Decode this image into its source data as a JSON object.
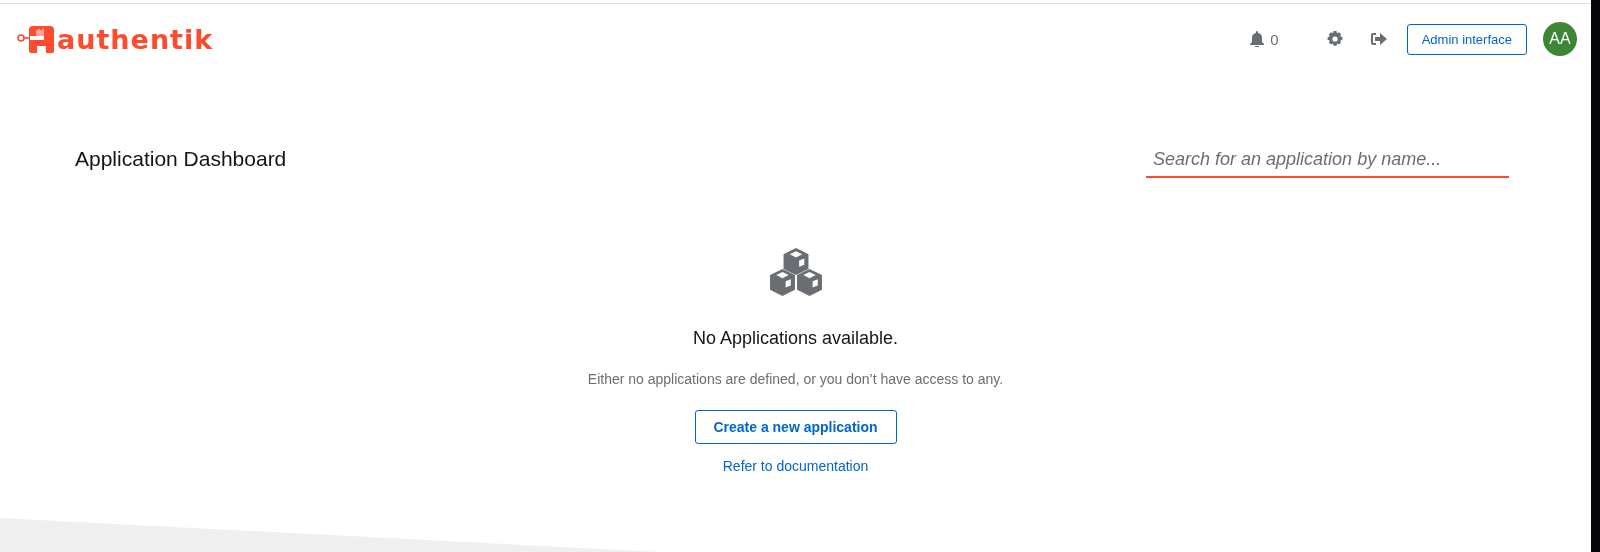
{
  "header": {
    "brand": "authentik",
    "notifications": {
      "count": "0"
    },
    "admin_button": "Admin interface",
    "avatar": "AA"
  },
  "dashboard": {
    "title": "Application Dashboard",
    "search": {
      "placeholder": "Search for an application by name..."
    }
  },
  "empty_state": {
    "title": "No Applications available.",
    "message": "Either no applications are defined, or you don’t have access to any.",
    "create_button": "Create a new application",
    "docs_link": "Refer to documentation"
  }
}
